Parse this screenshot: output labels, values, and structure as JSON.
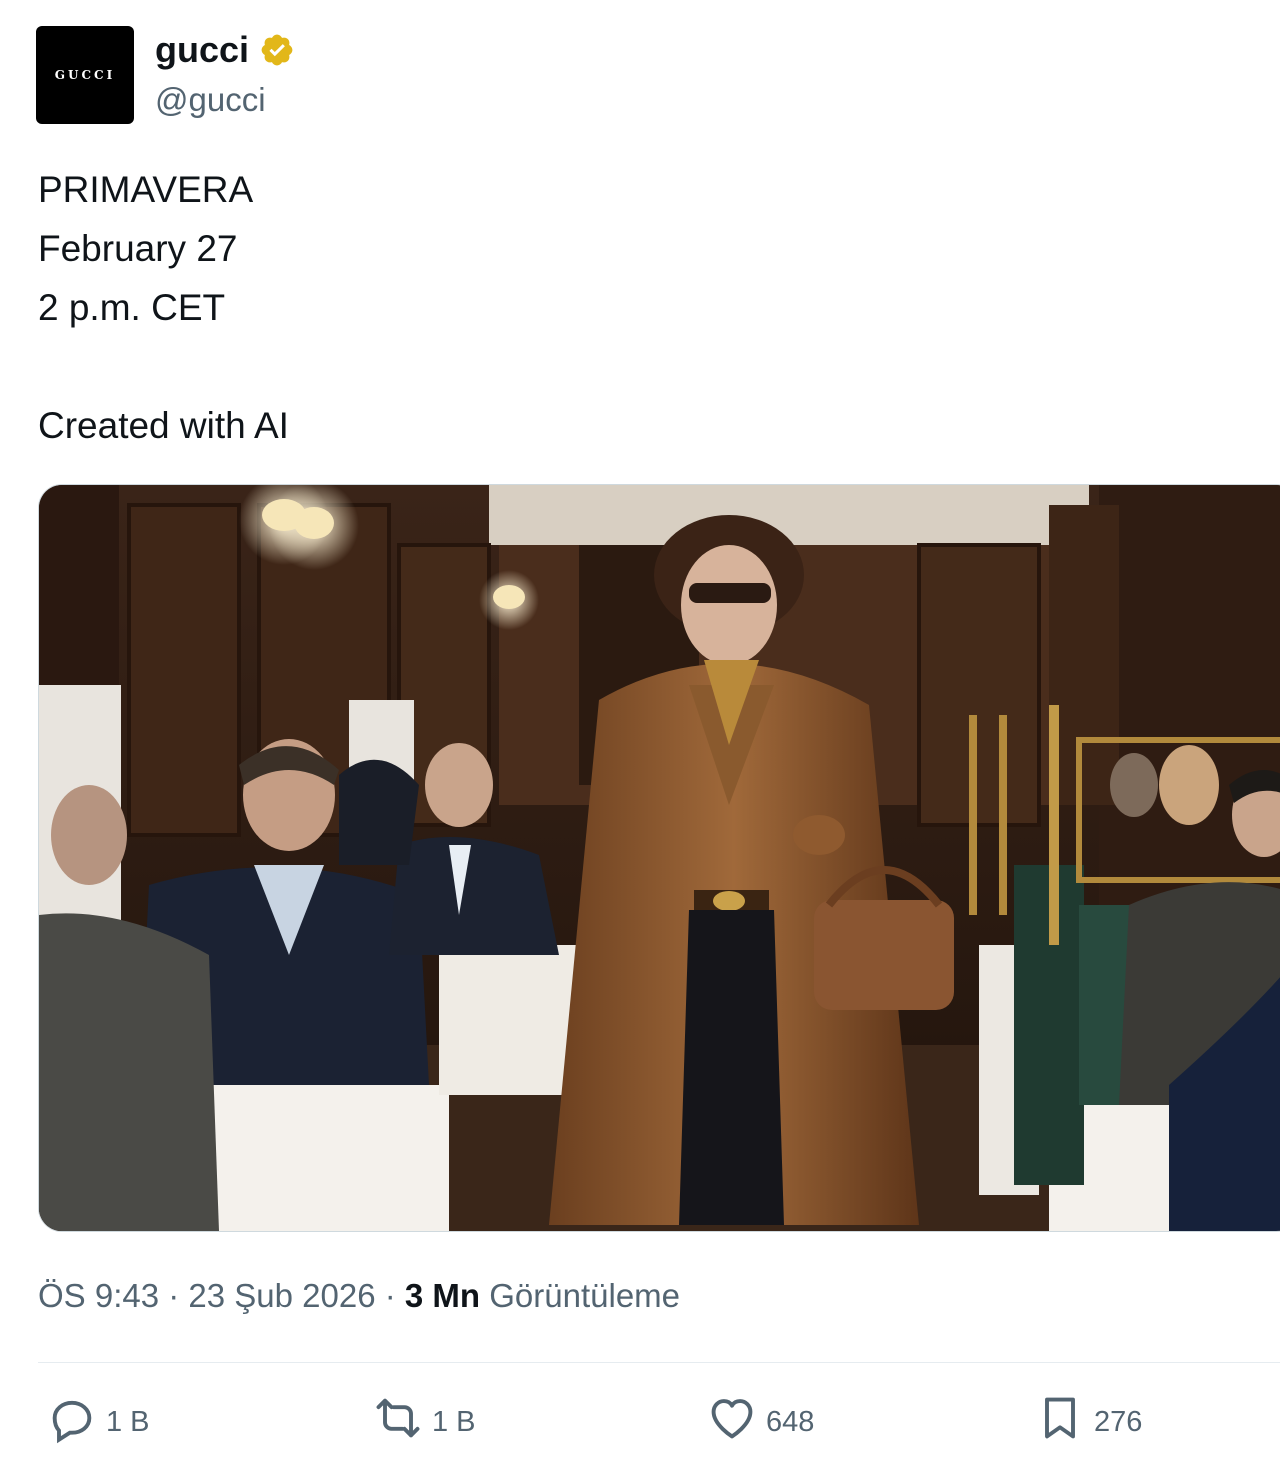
{
  "author": {
    "avatar_text": "GUCCI",
    "name": "gucci",
    "handle": "@gucci",
    "verified_badge_color": "#e2b719"
  },
  "tweet": {
    "lines": [
      "PRIMAVERA",
      "February 27",
      "2 p.m. CET",
      "",
      "Created with AI"
    ],
    "media_alt": "Woman in fur coat walking through restaurant"
  },
  "meta": {
    "time": "ÖS 9:43",
    "separator": " · ",
    "date": "23 Şub 2026",
    "views_count": "3 Mn",
    "views_label": "Görüntüleme"
  },
  "actions": {
    "reply_count": "1 B",
    "retweet_count": "1 B",
    "like_count": "648",
    "bookmark_count": "276"
  },
  "icons": {
    "reply": "speech-bubble-icon",
    "retweet": "retweet-arrows-icon",
    "like": "heart-icon",
    "bookmark": "bookmark-icon",
    "verified": "verified-badge-icon"
  },
  "colors": {
    "text_primary": "#0f1419",
    "text_secondary": "#536471",
    "divider": "#e6ecf0",
    "verified": "#e2b719"
  }
}
